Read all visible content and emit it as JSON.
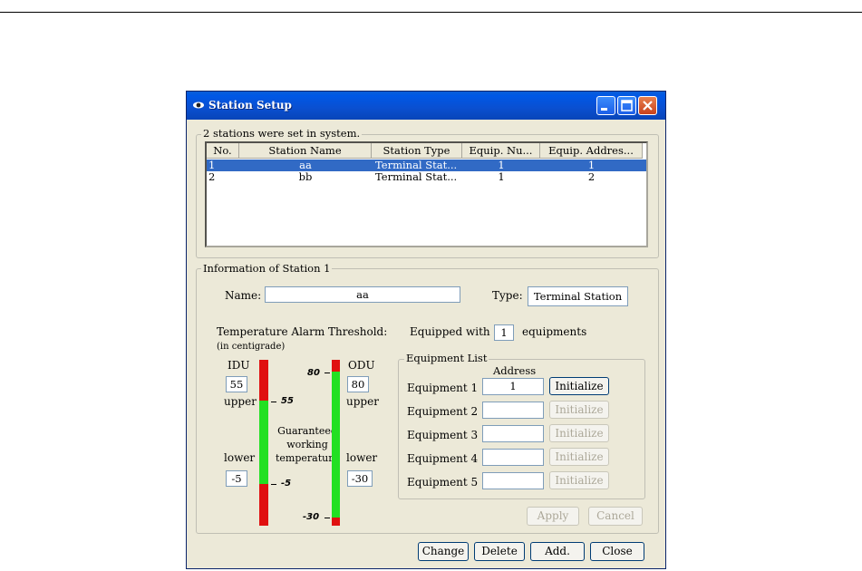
{
  "window": {
    "title": "Station Setup"
  },
  "stations_group": {
    "legend": "2 stations were set in system.",
    "columns": [
      "No.",
      "Station Name",
      "Station Type",
      "Equip. Nu...",
      "Equip. Addres..."
    ],
    "rows": [
      {
        "no": "1",
        "name": "aa",
        "type": "Terminal Stat...",
        "equip_num": "1",
        "equip_addr": "1",
        "selected": true
      },
      {
        "no": "2",
        "name": "bb",
        "type": "Terminal Stat...",
        "equip_num": "1",
        "equip_addr": "2",
        "selected": false
      }
    ]
  },
  "info_group": {
    "legend": "Information of Station 1",
    "name_label": "Name:",
    "name_value": "aa",
    "type_label": "Type:",
    "type_value": "Terminal Station",
    "temp_label": "Temperature Alarm Threshold:",
    "temp_unit": "(in centigrade)",
    "equipped_prefix": "Equipped with",
    "equipped_count": "1",
    "equipped_suffix": "equipments"
  },
  "idu": {
    "label": "IDU",
    "upper_value": "55",
    "upper_label": "upper",
    "lower_label": "lower",
    "lower_value": "-5",
    "mark_upper": "55",
    "mark_lower": "-5"
  },
  "guaranteed_text": {
    "line1": "Guaranteed",
    "line2": "working",
    "line3": "temperature"
  },
  "odu": {
    "label": "ODU",
    "upper_value": "80",
    "upper_label": "upper",
    "lower_label": "lower",
    "lower_value": "-30",
    "mark_upper": "80",
    "mark_lower": "-30"
  },
  "equipment_list": {
    "legend": "Equipment List",
    "address_header": "Address",
    "items": [
      {
        "label": "Equipment 1",
        "address": "1",
        "button": "Initialize",
        "enabled": true
      },
      {
        "label": "Equipment 2",
        "address": "",
        "button": "Initialize",
        "enabled": false
      },
      {
        "label": "Equipment 3",
        "address": "",
        "button": "Initialize",
        "enabled": false
      },
      {
        "label": "Equipment 4",
        "address": "",
        "button": "Initialize",
        "enabled": false
      },
      {
        "label": "Equipment 5",
        "address": "",
        "button": "Initialize",
        "enabled": false
      }
    ]
  },
  "actions": {
    "apply": "Apply",
    "cancel": "Cancel",
    "change": "Change",
    "delete": "Delete",
    "add": "Add.",
    "close": "Close"
  },
  "colors": {
    "titlebar": "#0a4fd0",
    "selection": "#316ac5",
    "bar_red": "#e01010",
    "bar_green": "#22e022"
  }
}
